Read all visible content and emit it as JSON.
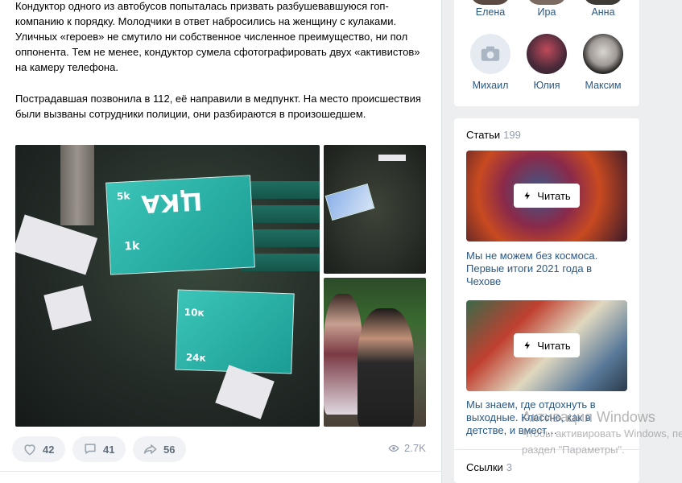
{
  "post": {
    "para1": "Кондуктор одного из автобусов попыталась призвать разбушевавшуюся гоп-компанию к порядку. Молодчики в ответ набросились на женщину с кулаками. Уличных «героев» не смутило ни собственное численное преимущество, ни пол оппонента. Тем не менее, кондуктор сумела сфотографировать двух «активистов» на камеру телефона.",
    "para2": "Пострадавшая позвонила в 112, её направили в медпункт. На место происшествия были вызваны сотрудники полиции, они разбираются в произошедшем.",
    "ticket_big": "ЦКА",
    "ticket_1k": "1k",
    "ticket_5k": "5k",
    "ticket_10k": "10к",
    "ticket_24k": "24к",
    "actions": {
      "likes": "42",
      "comments": "41",
      "shares": "56",
      "views": "2.7K"
    }
  },
  "friends": [
    {
      "name": "Елена"
    },
    {
      "name": "Ира"
    },
    {
      "name": "Анна"
    },
    {
      "name": "Михаил"
    },
    {
      "name": "Юлия"
    },
    {
      "name": "Максим"
    }
  ],
  "articles": {
    "title": "Статьи",
    "count": "199",
    "read_label": "Читать",
    "items": [
      {
        "title": "Мы не можем без космоса. Первые итоги 2021 года в Чехове"
      },
      {
        "title": "Мы знаем, где отдохнуть в выходные. Классно, как в детстве, и вмест…"
      }
    ]
  },
  "links": {
    "title": "Ссылки",
    "count": "3"
  },
  "watermark": {
    "line1": "Активация Windows",
    "line2": "Чтобы активировать Windows, перейдите в",
    "line3": "раздел \"Параметры\"."
  },
  "colors": {
    "link": "#2a5885",
    "muted": "#939cb0",
    "pill_bg": "#f0f2f5",
    "page_bg": "#edeef0"
  }
}
